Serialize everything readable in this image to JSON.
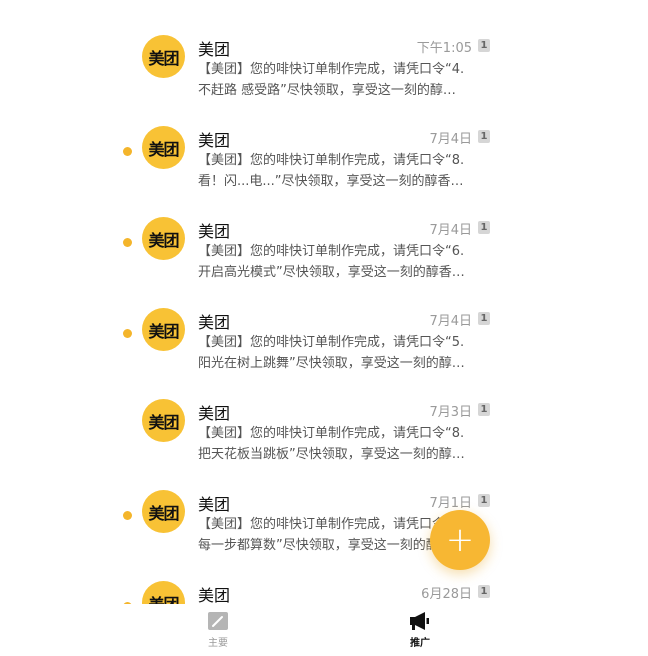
{
  "messages": [
    {
      "sender": "美团",
      "avatar_text": "美团",
      "time": "下午1:05",
      "count": "1",
      "unread": false,
      "line1": "【美团】您的啡快订单制作完成，请凭口令“4.",
      "line2": "不赶路 感受路”尽快领取，享受这一刻的醇…"
    },
    {
      "sender": "美团",
      "avatar_text": "美团",
      "time": "7月4日",
      "count": "1",
      "unread": true,
      "line1": "【美团】您的啡快订单制作完成，请凭口令“8.",
      "line2": "看！闪...电...”尽快领取，享受这一刻的醇香…"
    },
    {
      "sender": "美团",
      "avatar_text": "美团",
      "time": "7月4日",
      "count": "1",
      "unread": true,
      "line1": "【美团】您的啡快订单制作完成，请凭口令“6.",
      "line2": "开启高光模式”尽快领取，享受这一刻的醇香…"
    },
    {
      "sender": "美团",
      "avatar_text": "美团",
      "time": "7月4日",
      "count": "1",
      "unread": true,
      "line1": "【美团】您的啡快订单制作完成，请凭口令“5.",
      "line2": "阳光在树上跳舞”尽快领取，享受这一刻的醇…"
    },
    {
      "sender": "美团",
      "avatar_text": "美团",
      "time": "7月3日",
      "count": "1",
      "unread": false,
      "line1": "【美团】您的啡快订单制作完成，请凭口令“8.",
      "line2": "把天花板当跳板”尽快领取，享受这一刻的醇…"
    },
    {
      "sender": "美团",
      "avatar_text": "美团",
      "time": "7月1日",
      "count": "1",
      "unread": true,
      "line1": "【美团】您的啡快订单制作完成，请凭口令“",
      "line2": "每一步都算数”尽快领取，享受这一刻的醇…"
    },
    {
      "sender": "美团",
      "avatar_text": "美团",
      "time": "6月28日",
      "count": "1",
      "unread": true,
      "line1": "",
      "line2": ""
    }
  ],
  "fab": {
    "icon": "plus-icon",
    "label": "+"
  },
  "tabbar": {
    "home": {
      "label": "主要",
      "icon": "compose-icon"
    },
    "promo": {
      "label": "推广",
      "icon": "megaphone-icon"
    }
  },
  "colors": {
    "accent": "#f7b733",
    "avatar": "#f8c235",
    "unread_dot": "#f4b52b"
  }
}
